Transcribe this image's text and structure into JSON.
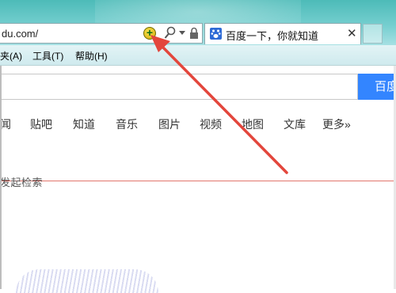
{
  "address_bar": {
    "url": "du.com/"
  },
  "tab": {
    "title": "百度一下，你就知道",
    "close": "✕"
  },
  "menu": {
    "items": [
      "夹(A)",
      "工具(T)",
      "帮助(H)"
    ]
  },
  "search": {
    "button_label": "百度"
  },
  "nav": {
    "items": [
      "闻",
      "贴吧",
      "知道",
      "音乐",
      "图片",
      "视频",
      "地图",
      "文库"
    ],
    "more": "更多»"
  },
  "content": {
    "bottom_text": "发起检索"
  },
  "icons": {
    "addon": "add-on-plus-icon",
    "search": "search-icon",
    "dropdown": "dropdown-icon",
    "lock": "lock-icon",
    "favicon": "baidu-paw-icon"
  },
  "colors": {
    "search_button": "#3385ff",
    "annotation_arrow": "#e3463c",
    "divider": "#e2766d"
  }
}
